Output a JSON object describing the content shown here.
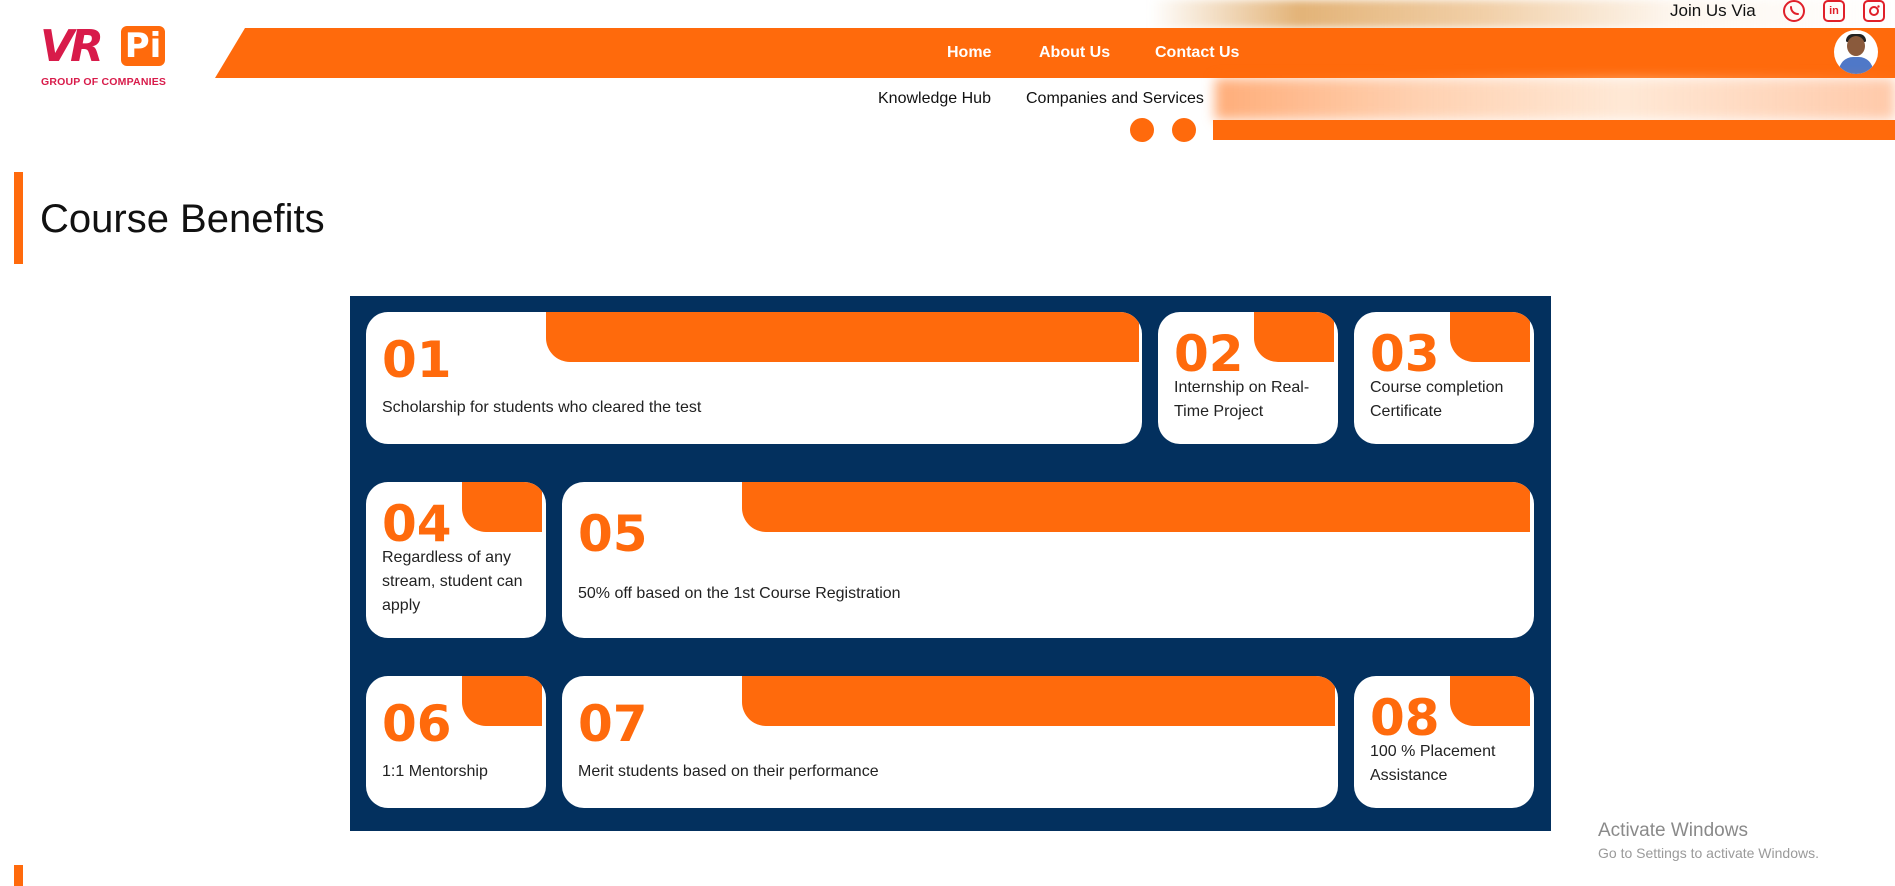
{
  "logo": {
    "vr": "VR",
    "pi": "Pi",
    "subtitle": "GROUP OF COMPANIES"
  },
  "header": {
    "join_label": "Join Us Via",
    "social": [
      {
        "icon": "whatsapp-icon"
      },
      {
        "icon": "linkedin-icon",
        "glyph": "in"
      },
      {
        "icon": "instagram-icon"
      }
    ]
  },
  "nav": {
    "primary": [
      "Home",
      "About Us",
      "Contact Us"
    ],
    "secondary": [
      "Knowledge Hub",
      "Companies and Services"
    ]
  },
  "page": {
    "title": "Course Benefits"
  },
  "benefits": [
    {
      "num": "01",
      "text": "Scholarship for students who cleared the test"
    },
    {
      "num": "02",
      "text": "Internship on Real-Time Project"
    },
    {
      "num": "03",
      "text": "Course completion Certificate"
    },
    {
      "num": "04",
      "text": "Regardless of any stream, student can apply"
    },
    {
      "num": "05",
      "text": "50% off based on the 1st Course Registration"
    },
    {
      "num": "06",
      "text": "1:1 Mentorship"
    },
    {
      "num": "07",
      "text": "Merit students based on their performance"
    },
    {
      "num": "08",
      "text": "100 % Placement Assistance"
    }
  ],
  "watermark": {
    "line1": "Activate Windows",
    "line2": "Go to Settings to activate Windows."
  },
  "colors": {
    "accent": "#ff6a0c",
    "panel": "#03305e",
    "brand_red": "#d81b4a",
    "social": "#e0202a"
  }
}
